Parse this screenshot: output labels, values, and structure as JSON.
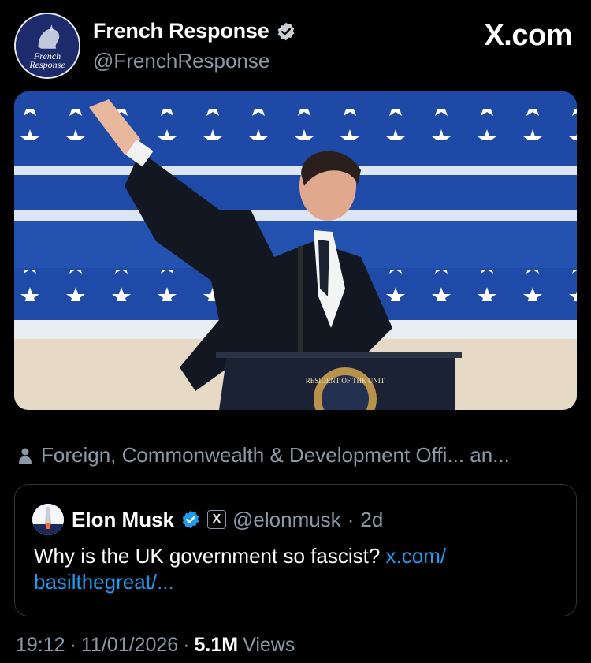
{
  "author": {
    "display_name": "French Response",
    "handle": "@FrenchResponse",
    "avatar_text_line1": "French",
    "avatar_text_line2": "Response"
  },
  "site_label": "X.com",
  "media": {
    "description_icon": "person-silhouette-icon",
    "podium_seal_text": "RESIDENT OF THE UNIT"
  },
  "context": {
    "icon": "person-icon",
    "text": "Foreign, Commonwealth & Development Offi... an..."
  },
  "quoted_post": {
    "display_name": "Elon Musk",
    "handle": "@elonmusk",
    "separator": "·",
    "age": "2d",
    "x_badge": "X",
    "text": "Why is the UK government so fascist? ",
    "link_line1": "x.com/",
    "link_line2": "basilthegreat/..."
  },
  "meta": {
    "time": "19:12",
    "sep1": "·",
    "date": "11/01/2026",
    "sep2": "·",
    "views_count": "5.1M",
    "views_label": "Views"
  },
  "colors": {
    "background": "#000000",
    "muted": "#8b98a5",
    "link": "#1d9bf0",
    "verified": "#1d9bf0"
  }
}
